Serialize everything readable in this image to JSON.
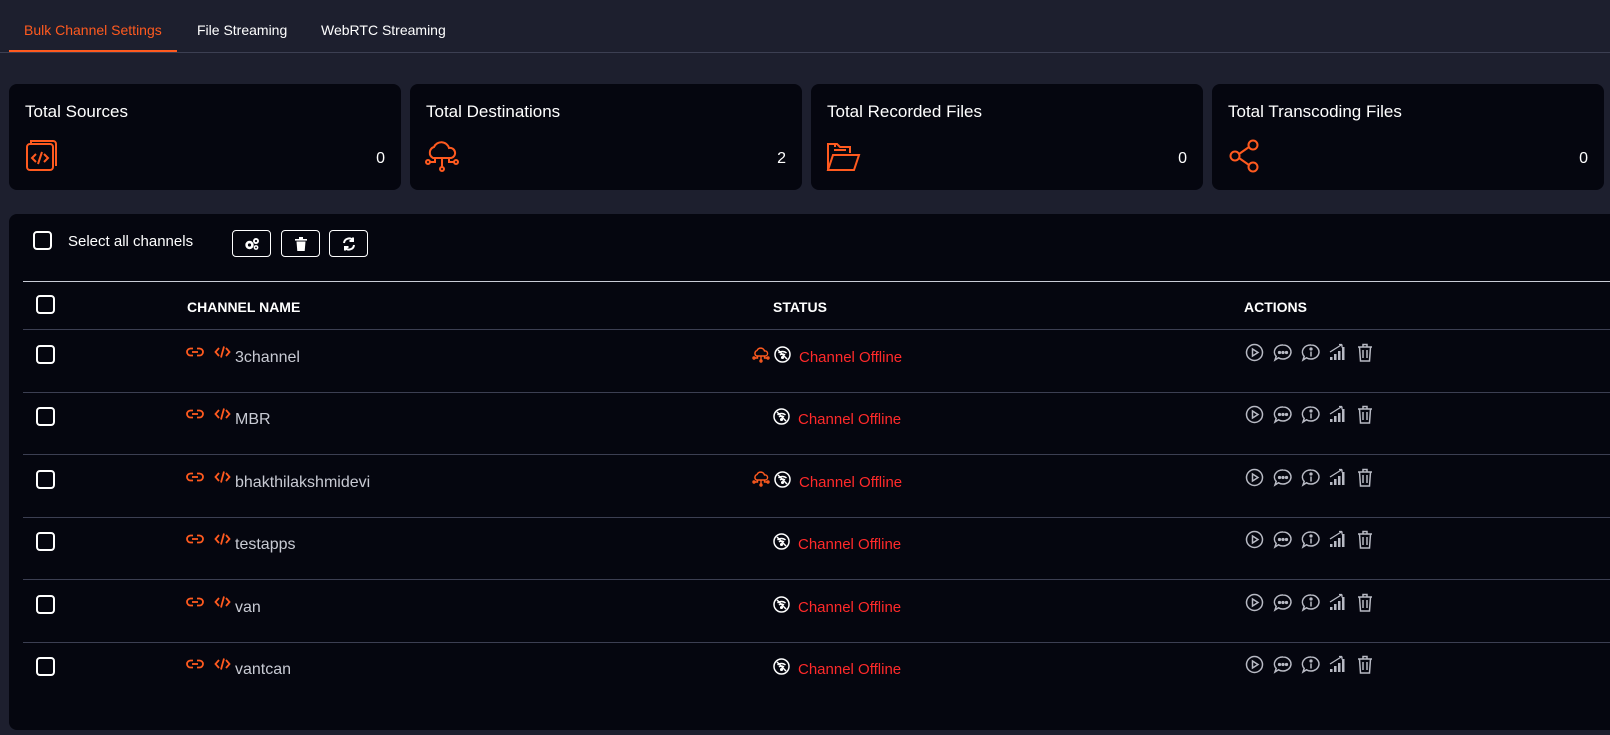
{
  "tabs": [
    {
      "label": "Bulk Channel Settings",
      "active": true
    },
    {
      "label": "File Streaming",
      "active": false
    },
    {
      "label": "WebRTC Streaming",
      "active": false
    }
  ],
  "cards": [
    {
      "title": "Total Sources",
      "value": "0",
      "icon": "source-code-book-icon"
    },
    {
      "title": "Total Destinations",
      "value": "2",
      "icon": "cloud-network-icon"
    },
    {
      "title": "Total Recorded Files",
      "value": "0",
      "icon": "open-folder-icon"
    },
    {
      "title": "Total Transcoding Files",
      "value": "0",
      "icon": "share-icon"
    }
  ],
  "toolbar": {
    "select_all_label": "Select all channels",
    "buttons": [
      "settings-gears-icon",
      "trash-icon",
      "refresh-icon"
    ]
  },
  "table": {
    "headers": {
      "name": "CHANNEL NAME",
      "status": "STATUS",
      "actions": "ACTIONS"
    },
    "rows": [
      {
        "name": "3channel",
        "status": "Channel Offline",
        "has_destination": true
      },
      {
        "name": "MBR",
        "status": "Channel Offline",
        "has_destination": false
      },
      {
        "name": "bhakthilakshmidevi",
        "status": "Channel Offline",
        "has_destination": true
      },
      {
        "name": "testapps",
        "status": "Channel Offline",
        "has_destination": false
      },
      {
        "name": "van",
        "status": "Channel Offline",
        "has_destination": false
      },
      {
        "name": "vantcan",
        "status": "Channel Offline",
        "has_destination": false
      }
    ],
    "action_icons": [
      "play-icon",
      "chat-icon",
      "info-icon",
      "signal-bars-icon",
      "trash-icon"
    ]
  },
  "colors": {
    "accent": "#ff5a1f",
    "offline": "#ff2a2a",
    "background": "#1d1f2e",
    "panel": "#05060f"
  }
}
